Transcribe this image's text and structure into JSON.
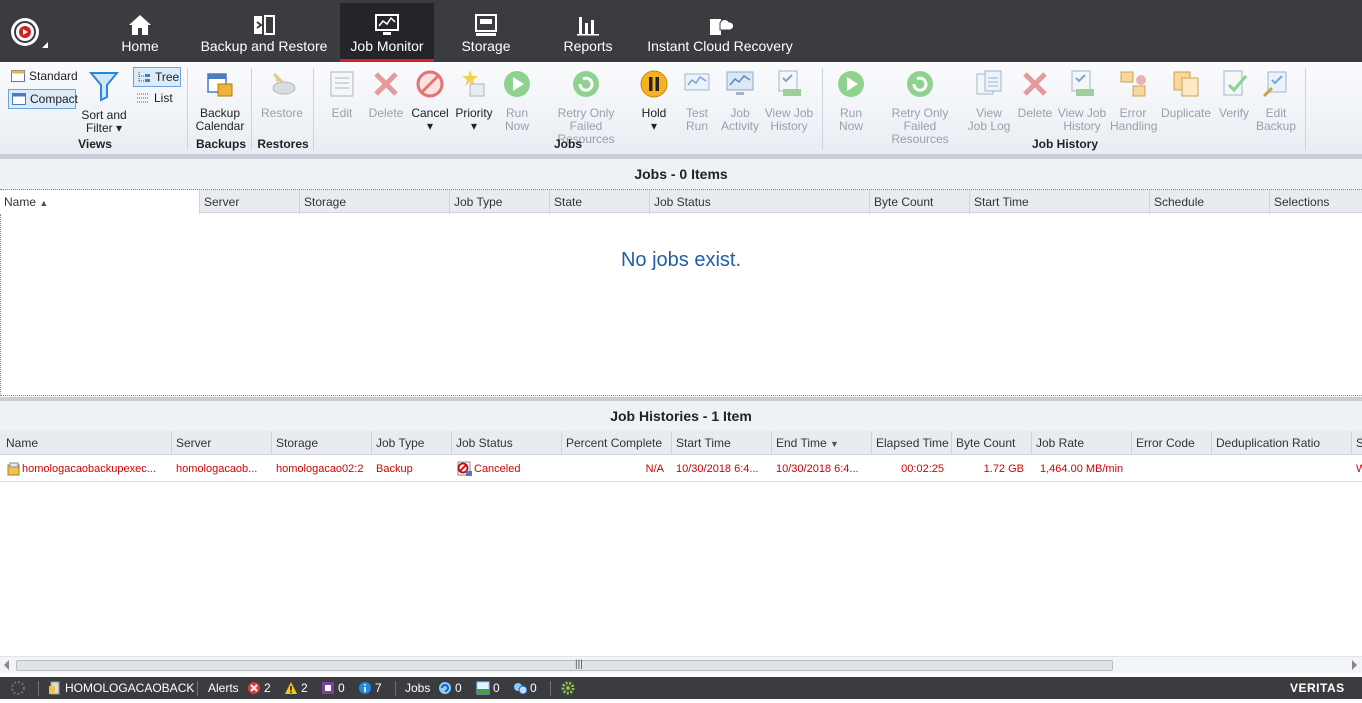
{
  "nav": {
    "tabs": [
      {
        "label": "Home",
        "icon": "home-icon"
      },
      {
        "label": "Backup and Restore",
        "icon": "backup-restore-icon"
      },
      {
        "label": "Job Monitor",
        "icon": "monitor-icon",
        "active": true
      },
      {
        "label": "Storage",
        "icon": "storage-icon"
      },
      {
        "label": "Reports",
        "icon": "reports-icon"
      },
      {
        "label": "Instant Cloud Recovery",
        "icon": "cloud-recovery-icon"
      }
    ]
  },
  "ribbon": {
    "views": {
      "standard": "Standard",
      "compact": "Compact",
      "tree": "Tree",
      "list": "List",
      "sort_filter_1": "Sort and",
      "sort_filter_2": "Filter",
      "group": "Views"
    },
    "backups": {
      "calendar_1": "Backup",
      "calendar_2": "Calendar",
      "group": "Backups"
    },
    "restores": {
      "restore": "Restore",
      "group": "Restores"
    },
    "jobs": {
      "edit": "Edit",
      "delete": "Delete",
      "cancel": "Cancel",
      "priority": "Priority",
      "run_now_1": "Run",
      "run_now_2": "Now",
      "retry_1": "Retry Only Failed",
      "retry_2": "Resources",
      "hold": "Hold",
      "test_run_1": "Test",
      "test_run_2": "Run",
      "job_activity_1": "Job",
      "job_activity_2": "Activity",
      "view_history_1": "View Job",
      "view_history_2": "History",
      "group": "Jobs"
    },
    "job_history": {
      "run_now_1": "Run",
      "run_now_2": "Now",
      "retry_1": "Retry Only Failed",
      "retry_2": "Resources",
      "view_log_1": "View",
      "view_log_2": "Job Log",
      "delete": "Delete",
      "view_history_1": "View Job",
      "view_history_2": "History",
      "error_1": "Error",
      "error_2": "Handling",
      "duplicate": "Duplicate",
      "verify": "Verify",
      "edit_backup_1": "Edit",
      "edit_backup_2": "Backup",
      "group": "Job History"
    }
  },
  "jobs_panel": {
    "title": "Jobs - 0 Items",
    "columns": [
      "Name",
      "Server",
      "Storage",
      "Job Type",
      "State",
      "Job Status",
      "Byte Count",
      "Start Time",
      "Schedule",
      "Selections"
    ],
    "empty_message": "No jobs exist."
  },
  "history_panel": {
    "title": "Job Histories - 1 Item",
    "columns": [
      "Name",
      "Server",
      "Storage",
      "Job Type",
      "Job Status",
      "Percent Complete",
      "Start Time",
      "End Time",
      "Elapsed Time",
      "Byte Count",
      "Job Rate",
      "Error Code",
      "Deduplication Ratio",
      "S"
    ],
    "rows": [
      {
        "name": "homologacaobackupexec...",
        "server": "homologacaob...",
        "storage": "homologacao02:2",
        "job_type": "Backup",
        "job_status": "Canceled",
        "percent_complete": "N/A",
        "start_time": "10/30/2018 6:4...",
        "end_time": "10/30/2018 6:4...",
        "elapsed_time": "00:02:25",
        "byte_count": "1.72 GB",
        "job_rate": "1,464.00 MB/min",
        "error_code": "",
        "dedup_ratio": "",
        "s": "W"
      }
    ]
  },
  "status_bar": {
    "server": "HOMOLOGACAOBACK",
    "alerts_label": "Alerts",
    "alerts_error": "2",
    "alerts_warning": "2",
    "alerts_media": "0",
    "alerts_info": "7",
    "jobs_label": "Jobs",
    "jobs_active": "0",
    "jobs_scheduled": "0",
    "jobs_other": "0",
    "brand": "VERITAS"
  },
  "colors": {
    "nav_bg": "#3a3c40",
    "active_accent": "#d31f26",
    "error_text": "#d40000",
    "link_blue": "#1f5ea8"
  }
}
